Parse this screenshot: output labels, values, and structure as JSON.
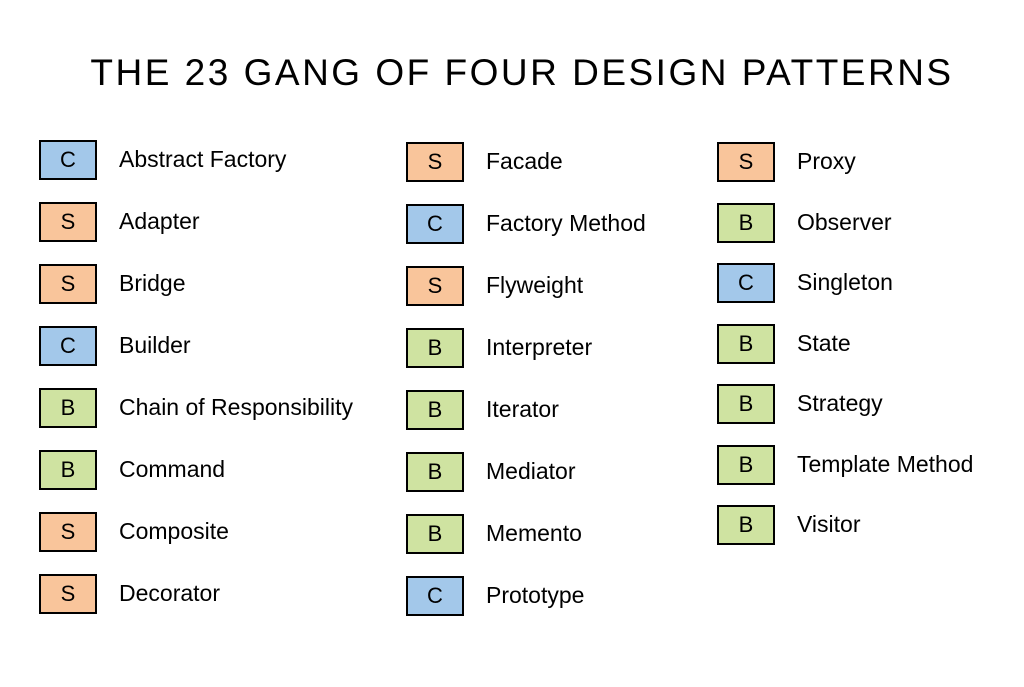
{
  "title": "THE 23 GANG OF FOUR DESIGN PATTERNS",
  "category_colors": {
    "C": "#a3c8ea",
    "S": "#f9c59b",
    "B": "#cfe3a1"
  },
  "columns": [
    [
      {
        "type": "C",
        "name": "Abstract Factory"
      },
      {
        "type": "S",
        "name": "Adapter"
      },
      {
        "type": "S",
        "name": "Bridge"
      },
      {
        "type": "C",
        "name": "Builder"
      },
      {
        "type": "B",
        "name": "Chain of Responsibility"
      },
      {
        "type": "B",
        "name": "Command"
      },
      {
        "type": "S",
        "name": "Composite"
      },
      {
        "type": "S",
        "name": "Decorator"
      }
    ],
    [
      {
        "type": "S",
        "name": "Facade"
      },
      {
        "type": "C",
        "name": "Factory Method"
      },
      {
        "type": "S",
        "name": "Flyweight"
      },
      {
        "type": "B",
        "name": "Interpreter"
      },
      {
        "type": "B",
        "name": "Iterator"
      },
      {
        "type": "B",
        "name": "Mediator"
      },
      {
        "type": "B",
        "name": "Memento"
      },
      {
        "type": "C",
        "name": "Prototype"
      }
    ],
    [
      {
        "type": "S",
        "name": "Proxy"
      },
      {
        "type": "B",
        "name": "Observer"
      },
      {
        "type": "C",
        "name": "Singleton"
      },
      {
        "type": "B",
        "name": "State"
      },
      {
        "type": "B",
        "name": "Strategy"
      },
      {
        "type": "B",
        "name": "Template Method"
      },
      {
        "type": "B",
        "name": "Visitor"
      }
    ]
  ]
}
